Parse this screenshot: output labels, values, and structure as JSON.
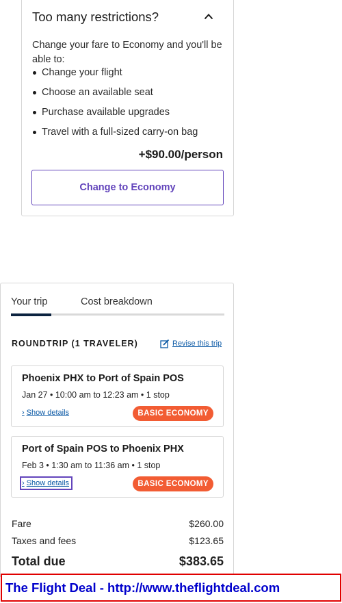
{
  "restrictions": {
    "title": "Too many restrictions?",
    "intro": "Change your fare to Economy and you'll be able to:",
    "benefits": [
      "Change your flight",
      "Choose an available seat",
      "Purchase available upgrades",
      "Travel with a full-sized carry-on bag"
    ],
    "price": "+$90.00/person",
    "button_label": "Change to Economy",
    "accent_color": "#6244bb"
  },
  "trip": {
    "tabs": [
      "Your trip",
      "Cost breakdown"
    ],
    "active_tab": "Your trip",
    "roundtrip_label": "ROUNDTRIP (1 TRAVELER)",
    "revise_label": "Revise this trip",
    "segments": [
      {
        "route": "Phoenix PHX to Port of Spain POS",
        "time": "Jan 27 • 10:00 am to 12:23 am • 1 stop",
        "details_label": "Show details",
        "fare_badge": "BASIC ECONOMY"
      },
      {
        "route": "Port of Spain POS to Phoenix PHX",
        "time": "Feb 3 • 1:30 am to 11:36 am • 1 stop",
        "details_label": "Show details",
        "fare_badge": "BASIC ECONOMY"
      }
    ],
    "summary": {
      "fare_label": "Fare",
      "fare_value": "$260.00",
      "taxes_label": "Taxes and fees",
      "taxes_value": "$123.65",
      "total_label": "Total due",
      "total_value": "$383.65"
    },
    "badge_color": "#f25c33"
  },
  "watermark": "The Flight Deal - http://www.theflightdeal.com"
}
